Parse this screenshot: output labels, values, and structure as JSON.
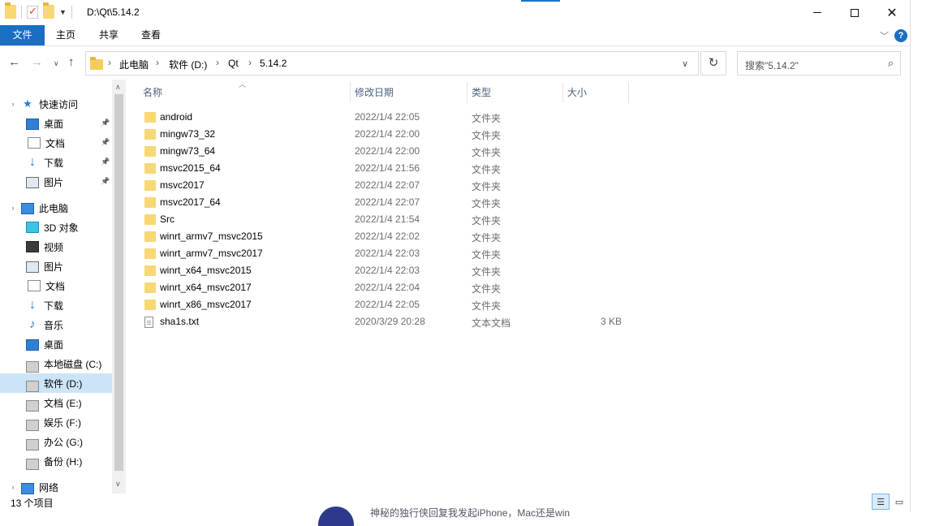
{
  "title_bar": {
    "path": "D:\\Qt\\5.14.2",
    "close_glyph": "✕"
  },
  "ribbon": {
    "tabs": [
      "文件",
      "主页",
      "共享",
      "查看"
    ],
    "help_glyph": "?"
  },
  "navigation": {
    "breadcrumbs": [
      "此电脑",
      "软件 (D:)",
      "Qt",
      "5.14.2"
    ],
    "search_placeholder": "搜索\"5.14.2\""
  },
  "sidebar": {
    "items": [
      {
        "label": "快速访问",
        "icon": "star-icon",
        "pinned": false,
        "selected": false,
        "level": 0
      },
      {
        "label": "桌面",
        "icon": "desktop-icon",
        "pinned": true,
        "selected": false,
        "level": 1
      },
      {
        "label": "文档",
        "icon": "document-icon",
        "pinned": true,
        "selected": false,
        "level": 1
      },
      {
        "label": "下载",
        "icon": "download-icon",
        "pinned": true,
        "selected": false,
        "level": 1
      },
      {
        "label": "图片",
        "icon": "picture-icon",
        "pinned": true,
        "selected": false,
        "level": 1
      },
      {
        "label": "此电脑",
        "icon": "computer-icon",
        "pinned": false,
        "selected": false,
        "level": 0
      },
      {
        "label": "3D 对象",
        "icon": "3d-objects-icon",
        "pinned": false,
        "selected": false,
        "level": 1
      },
      {
        "label": "视频",
        "icon": "video-icon",
        "pinned": false,
        "selected": false,
        "level": 1
      },
      {
        "label": "图片",
        "icon": "picture-icon",
        "pinned": false,
        "selected": false,
        "level": 1
      },
      {
        "label": "文档",
        "icon": "document-icon",
        "pinned": false,
        "selected": false,
        "level": 1
      },
      {
        "label": "下载",
        "icon": "download-icon",
        "pinned": false,
        "selected": false,
        "level": 1
      },
      {
        "label": "音乐",
        "icon": "music-icon",
        "pinned": false,
        "selected": false,
        "level": 1
      },
      {
        "label": "桌面",
        "icon": "desktop-icon",
        "pinned": false,
        "selected": false,
        "level": 1
      },
      {
        "label": "本地磁盘 (C:)",
        "icon": "system-drive-icon",
        "pinned": false,
        "selected": false,
        "level": 1
      },
      {
        "label": "软件 (D:)",
        "icon": "drive-icon",
        "pinned": false,
        "selected": true,
        "level": 1
      },
      {
        "label": "文档 (E:)",
        "icon": "drive-icon",
        "pinned": false,
        "selected": false,
        "level": 1
      },
      {
        "label": "娱乐 (F:)",
        "icon": "drive-icon",
        "pinned": false,
        "selected": false,
        "level": 1
      },
      {
        "label": "办公 (G:)",
        "icon": "drive-icon",
        "pinned": false,
        "selected": false,
        "level": 1
      },
      {
        "label": "备份 (H:)",
        "icon": "drive-icon",
        "pinned": false,
        "selected": false,
        "level": 1
      },
      {
        "label": "网络",
        "icon": "network-icon",
        "pinned": false,
        "selected": false,
        "level": 0
      }
    ]
  },
  "file_list": {
    "columns": [
      "名称",
      "修改日期",
      "类型",
      "大小"
    ],
    "rows": [
      {
        "name": "android",
        "date": "2022/1/4 22:05",
        "type": "文件夹",
        "size": "",
        "kind": "folder"
      },
      {
        "name": "mingw73_32",
        "date": "2022/1/4 22:00",
        "type": "文件夹",
        "size": "",
        "kind": "folder"
      },
      {
        "name": "mingw73_64",
        "date": "2022/1/4 22:00",
        "type": "文件夹",
        "size": "",
        "kind": "folder"
      },
      {
        "name": "msvc2015_64",
        "date": "2022/1/4 21:56",
        "type": "文件夹",
        "size": "",
        "kind": "folder"
      },
      {
        "name": "msvc2017",
        "date": "2022/1/4 22:07",
        "type": "文件夹",
        "size": "",
        "kind": "folder"
      },
      {
        "name": "msvc2017_64",
        "date": "2022/1/4 22:07",
        "type": "文件夹",
        "size": "",
        "kind": "folder"
      },
      {
        "name": "Src",
        "date": "2022/1/4 21:54",
        "type": "文件夹",
        "size": "",
        "kind": "folder"
      },
      {
        "name": "winrt_armv7_msvc2015",
        "date": "2022/1/4 22:02",
        "type": "文件夹",
        "size": "",
        "kind": "folder"
      },
      {
        "name": "winrt_armv7_msvc2017",
        "date": "2022/1/4 22:03",
        "type": "文件夹",
        "size": "",
        "kind": "folder"
      },
      {
        "name": "winrt_x64_msvc2015",
        "date": "2022/1/4 22:03",
        "type": "文件夹",
        "size": "",
        "kind": "folder"
      },
      {
        "name": "winrt_x64_msvc2017",
        "date": "2022/1/4 22:04",
        "type": "文件夹",
        "size": "",
        "kind": "folder"
      },
      {
        "name": "winrt_x86_msvc2017",
        "date": "2022/1/4 22:05",
        "type": "文件夹",
        "size": "",
        "kind": "folder"
      },
      {
        "name": "sha1s.txt",
        "date": "2020/3/29 20:28",
        "type": "文本文档",
        "size": "3 KB",
        "kind": "file"
      }
    ]
  },
  "status_bar": {
    "item_count": "13 个项目"
  },
  "background": {
    "partial_text": "神秘的独行侠回复我发起iPhone，Mac还是win"
  },
  "colors": {
    "accent": "#1a6fc4",
    "selection": "#cce4f7",
    "folder": "#f8d775",
    "header_text": "#4c607a",
    "secondary_text": "#6d6d6d"
  }
}
